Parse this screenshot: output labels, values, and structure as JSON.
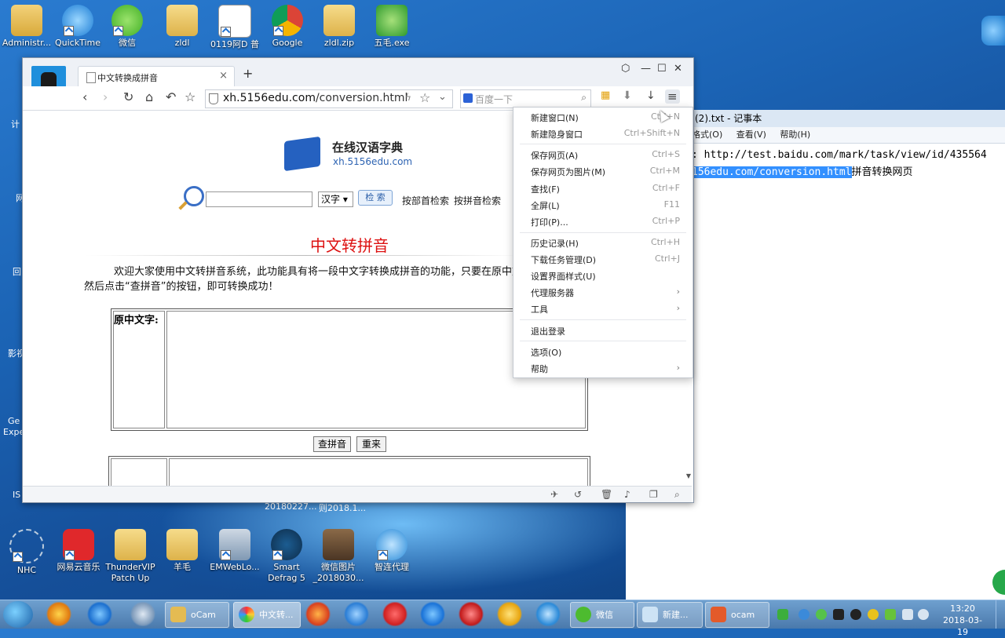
{
  "desktop": {
    "top_icons": [
      {
        "label": "Administr..."
      },
      {
        "label": "QuickTime"
      },
      {
        "label": "微信"
      },
      {
        "label": "zldl"
      },
      {
        "label": "0119阿D 普"
      },
      {
        "label": "Google"
      },
      {
        "label": "zldl.zip"
      },
      {
        "label": "五毛.exe"
      }
    ],
    "left_partial": [
      {
        "label": "计"
      },
      {
        "label": "网"
      },
      {
        "label": "回"
      },
      {
        "label": "影视"
      },
      {
        "label": "Ge"
      },
      {
        "label": "Expe"
      },
      {
        "label": "IS"
      }
    ],
    "bottom_icons": [
      {
        "label": "NHC"
      },
      {
        "label": "网易云音乐"
      },
      {
        "label": "ThunderVIP Patch Up"
      },
      {
        "label": "羊毛"
      },
      {
        "label": "EMWebLo..."
      },
      {
        "label": "Smart Defrag 5"
      },
      {
        "label": "微信图片 _2018030..."
      },
      {
        "label": "智连代理"
      }
    ],
    "hidden_labels": [
      "20180227...",
      "则2018.1..."
    ]
  },
  "notepad": {
    "title": "(2).txt - 记事本",
    "menu": [
      "格式(O)",
      "查看(V)",
      "帮助(H)"
    ],
    "line1": ": http://test.baidu.com/mark/task/view/id/435564",
    "line2_sel": "156edu.com/conversion.html",
    "line2_rest": "拼音转换网页"
  },
  "browser": {
    "tab_title": "中文转换成拼音",
    "url_host": "xh.5156edu.com",
    "url_path": "/conversion.html",
    "search_placeholder": "百度一下",
    "page": {
      "site_title": "在线汉语字典",
      "site_url": "xh.5156edu.com",
      "search_select": "汉字",
      "search_button": "检 索",
      "link_radical": "按部首检索",
      "link_pinyin": "按拼音检索",
      "heading": "中文转拼音",
      "intro_line1": "欢迎大家使用中文转拼音系统，此功能具有将一段中文字转换成拼音的功能，只要在原中文字的",
      "intro_line2": "然后点击“查拼音”的按钮，即可转换成功！",
      "source_label": "原中文字:",
      "btn_convert": "查拼音",
      "btn_reset": "重来"
    }
  },
  "menu": {
    "items": [
      {
        "label": "新建窗口(N)",
        "key": "Ctrl+N"
      },
      {
        "label": "新建隐身窗口",
        "key": "Ctrl+Shift+N"
      },
      {
        "label": "保存网页(A)",
        "key": "Ctrl+S"
      },
      {
        "label": "保存网页为图片(M)",
        "key": "Ctrl+M"
      },
      {
        "label": "查找(F)",
        "key": "Ctrl+F"
      },
      {
        "label": "全屏(L)",
        "key": "F11"
      },
      {
        "label": "打印(P)...",
        "key": "Ctrl+P"
      },
      {
        "label": "历史记录(H)",
        "key": "Ctrl+H"
      },
      {
        "label": "下载任务管理(D)",
        "key": "Ctrl+J"
      },
      {
        "label": "设置界面样式(U)",
        "key": ""
      },
      {
        "label": "代理服务器",
        "key": "›"
      },
      {
        "label": "工具",
        "key": "›"
      },
      {
        "label": "退出登录",
        "key": ""
      },
      {
        "label": "选项(O)",
        "key": ""
      },
      {
        "label": "帮助",
        "key": "›"
      }
    ]
  },
  "taskbar": {
    "windows": [
      {
        "label": "oCam"
      },
      {
        "label": "中文转..."
      },
      {
        "label": "微信"
      },
      {
        "label": "新建..."
      },
      {
        "label": "ocam"
      }
    ],
    "time": "13:20",
    "date": "2018-03-19"
  }
}
